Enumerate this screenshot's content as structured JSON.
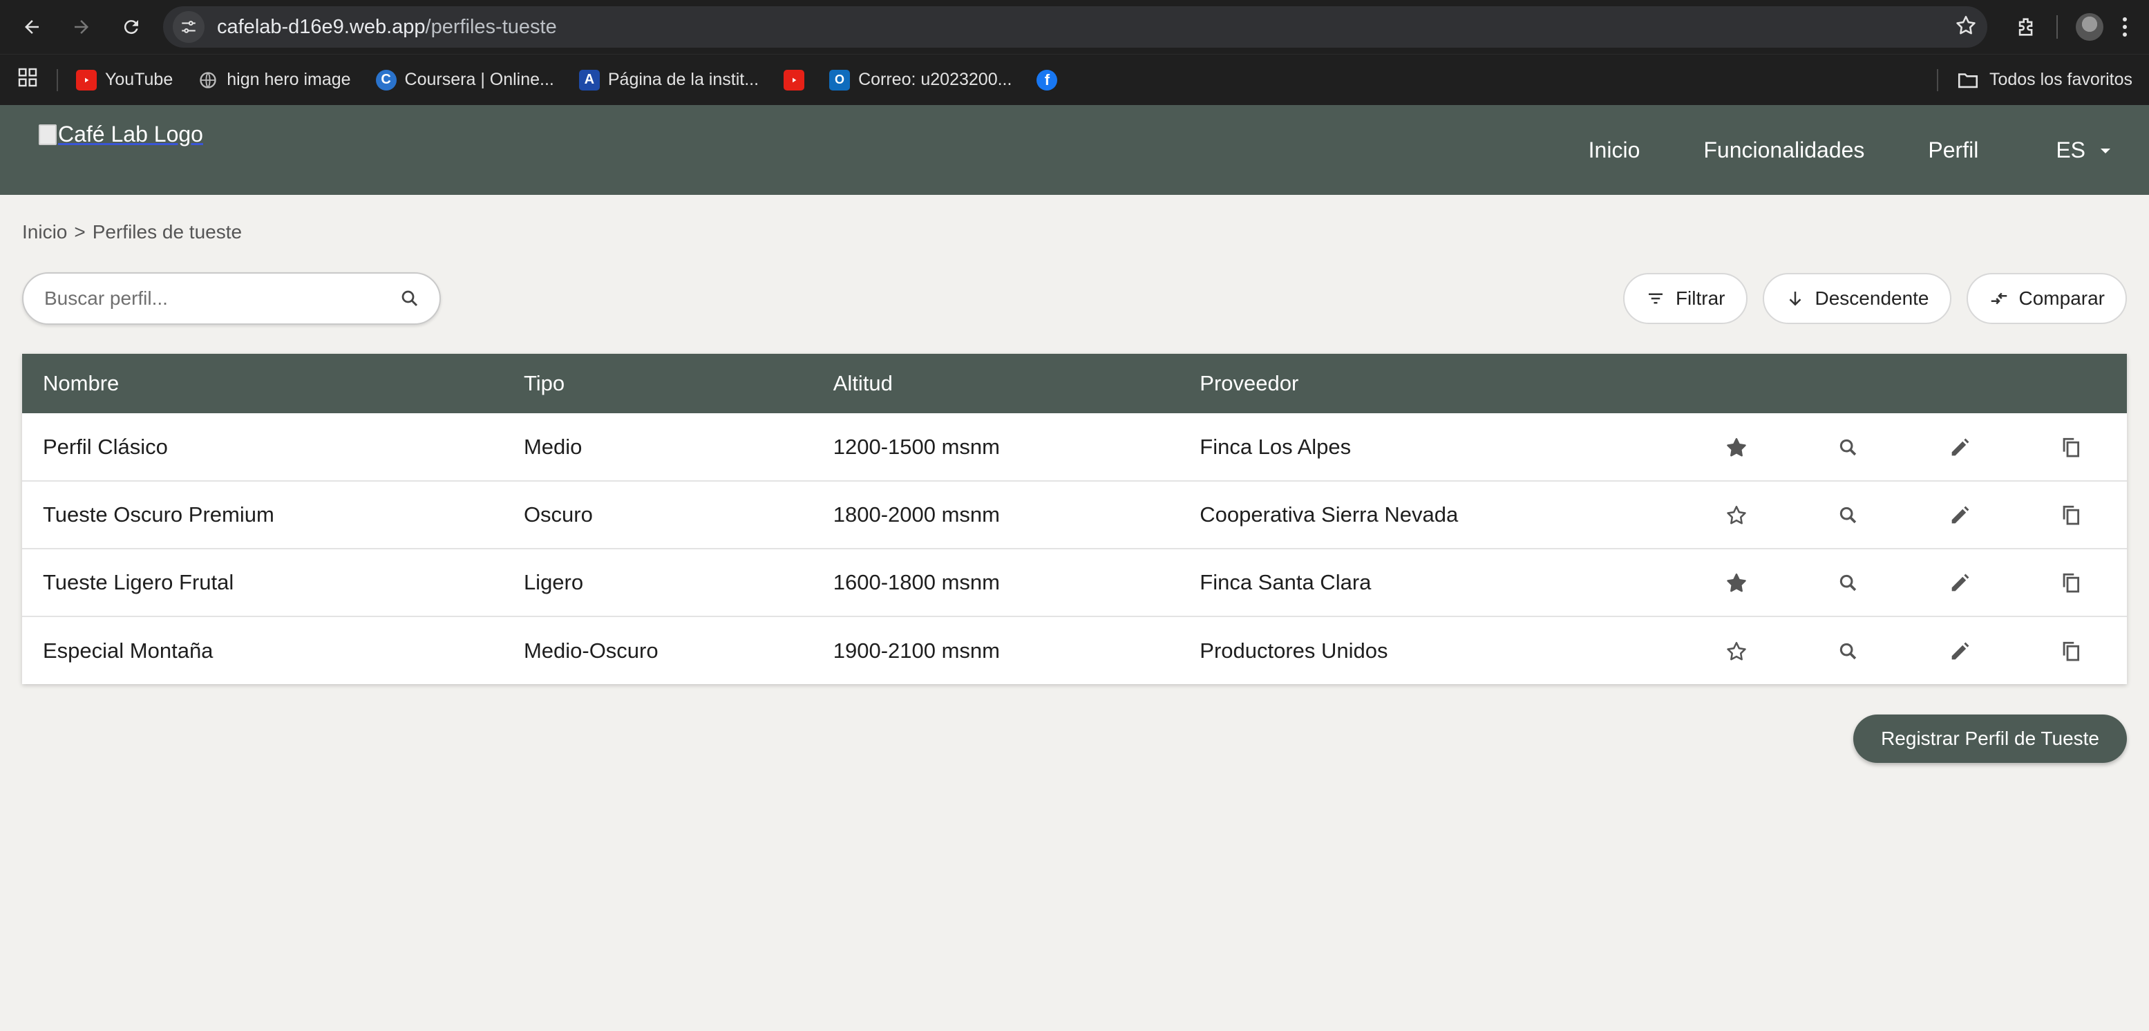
{
  "browser": {
    "url_host": "cafelab-d16e9.web.app",
    "url_path": "/perfiles-tueste",
    "bookmarks": [
      {
        "label": "YouTube",
        "icon": "youtube-icon"
      },
      {
        "label": "hign hero image",
        "icon": "globe-icon"
      },
      {
        "label": "Coursera | Online...",
        "icon": "coursera-icon"
      },
      {
        "label": "Página de la instit...",
        "icon": "institution-icon"
      },
      {
        "label": "",
        "icon": "youtube-icon"
      },
      {
        "label": "Correo: u2023200...",
        "icon": "outlook-icon"
      },
      {
        "label": "",
        "icon": "facebook-icon"
      }
    ],
    "all_bookmarks": "Todos los favoritos"
  },
  "header": {
    "logo_alt": "Café Lab Logo",
    "nav": [
      "Inicio",
      "Funcionalidades",
      "Perfil"
    ],
    "lang": "ES"
  },
  "breadcrumb": {
    "home": "Inicio",
    "sep": ">",
    "current": "Perfiles de tueste"
  },
  "search": {
    "placeholder": "Buscar perfil..."
  },
  "actions": {
    "filter": "Filtrar",
    "sort": "Descendente",
    "compare": "Comparar"
  },
  "table": {
    "headers": [
      "Nombre",
      "Tipo",
      "Altitud",
      "Proveedor"
    ],
    "rows": [
      {
        "nombre": "Perfil Clásico",
        "tipo": "Medio",
        "altitud": "1200-1500 msnm",
        "proveedor": "Finca Los Alpes",
        "favorite": true
      },
      {
        "nombre": "Tueste Oscuro Premium",
        "tipo": "Oscuro",
        "altitud": "1800-2000 msnm",
        "proveedor": "Cooperativa Sierra Nevada",
        "favorite": false
      },
      {
        "nombre": "Tueste Ligero Frutal",
        "tipo": "Ligero",
        "altitud": "1600-1800 msnm",
        "proveedor": "Finca Santa Clara",
        "favorite": true
      },
      {
        "nombre": "Especial Montaña",
        "tipo": "Medio-Oscuro",
        "altitud": "1900-2100 msnm",
        "proveedor": "Productores Unidos",
        "favorite": false
      }
    ]
  },
  "register_button": "Registrar Perfil de Tueste",
  "colors": {
    "primary": "#4d5b55",
    "background": "#f2f1ee"
  }
}
